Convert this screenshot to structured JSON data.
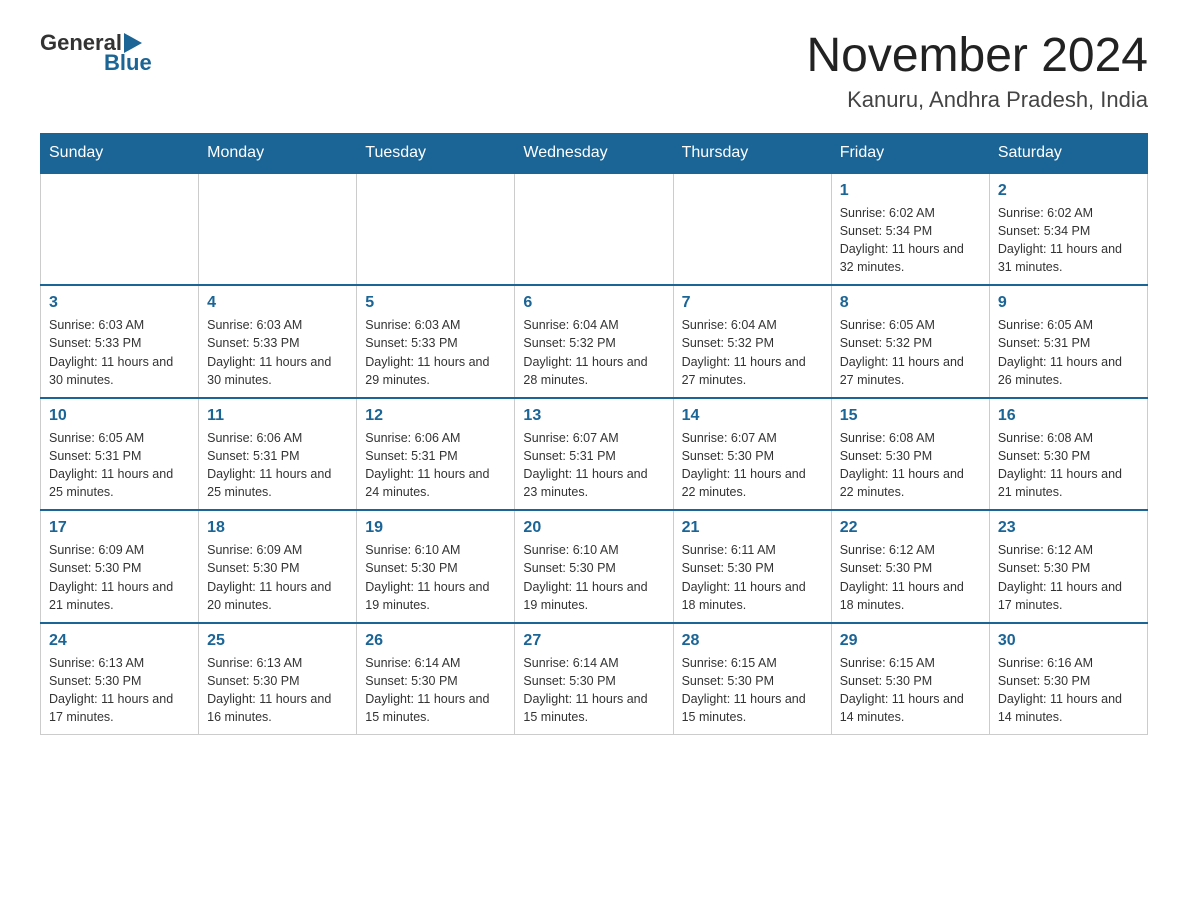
{
  "header": {
    "logo_general": "General",
    "logo_blue": "Blue",
    "title": "November 2024",
    "subtitle": "Kanuru, Andhra Pradesh, India"
  },
  "days_of_week": [
    "Sunday",
    "Monday",
    "Tuesday",
    "Wednesday",
    "Thursday",
    "Friday",
    "Saturday"
  ],
  "weeks": [
    [
      {
        "day": "",
        "sunrise": "",
        "sunset": "",
        "daylight": ""
      },
      {
        "day": "",
        "sunrise": "",
        "sunset": "",
        "daylight": ""
      },
      {
        "day": "",
        "sunrise": "",
        "sunset": "",
        "daylight": ""
      },
      {
        "day": "",
        "sunrise": "",
        "sunset": "",
        "daylight": ""
      },
      {
        "day": "",
        "sunrise": "",
        "sunset": "",
        "daylight": ""
      },
      {
        "day": "1",
        "sunrise": "Sunrise: 6:02 AM",
        "sunset": "Sunset: 5:34 PM",
        "daylight": "Daylight: 11 hours and 32 minutes."
      },
      {
        "day": "2",
        "sunrise": "Sunrise: 6:02 AM",
        "sunset": "Sunset: 5:34 PM",
        "daylight": "Daylight: 11 hours and 31 minutes."
      }
    ],
    [
      {
        "day": "3",
        "sunrise": "Sunrise: 6:03 AM",
        "sunset": "Sunset: 5:33 PM",
        "daylight": "Daylight: 11 hours and 30 minutes."
      },
      {
        "day": "4",
        "sunrise": "Sunrise: 6:03 AM",
        "sunset": "Sunset: 5:33 PM",
        "daylight": "Daylight: 11 hours and 30 minutes."
      },
      {
        "day": "5",
        "sunrise": "Sunrise: 6:03 AM",
        "sunset": "Sunset: 5:33 PM",
        "daylight": "Daylight: 11 hours and 29 minutes."
      },
      {
        "day": "6",
        "sunrise": "Sunrise: 6:04 AM",
        "sunset": "Sunset: 5:32 PM",
        "daylight": "Daylight: 11 hours and 28 minutes."
      },
      {
        "day": "7",
        "sunrise": "Sunrise: 6:04 AM",
        "sunset": "Sunset: 5:32 PM",
        "daylight": "Daylight: 11 hours and 27 minutes."
      },
      {
        "day": "8",
        "sunrise": "Sunrise: 6:05 AM",
        "sunset": "Sunset: 5:32 PM",
        "daylight": "Daylight: 11 hours and 27 minutes."
      },
      {
        "day": "9",
        "sunrise": "Sunrise: 6:05 AM",
        "sunset": "Sunset: 5:31 PM",
        "daylight": "Daylight: 11 hours and 26 minutes."
      }
    ],
    [
      {
        "day": "10",
        "sunrise": "Sunrise: 6:05 AM",
        "sunset": "Sunset: 5:31 PM",
        "daylight": "Daylight: 11 hours and 25 minutes."
      },
      {
        "day": "11",
        "sunrise": "Sunrise: 6:06 AM",
        "sunset": "Sunset: 5:31 PM",
        "daylight": "Daylight: 11 hours and 25 minutes."
      },
      {
        "day": "12",
        "sunrise": "Sunrise: 6:06 AM",
        "sunset": "Sunset: 5:31 PM",
        "daylight": "Daylight: 11 hours and 24 minutes."
      },
      {
        "day": "13",
        "sunrise": "Sunrise: 6:07 AM",
        "sunset": "Sunset: 5:31 PM",
        "daylight": "Daylight: 11 hours and 23 minutes."
      },
      {
        "day": "14",
        "sunrise": "Sunrise: 6:07 AM",
        "sunset": "Sunset: 5:30 PM",
        "daylight": "Daylight: 11 hours and 22 minutes."
      },
      {
        "day": "15",
        "sunrise": "Sunrise: 6:08 AM",
        "sunset": "Sunset: 5:30 PM",
        "daylight": "Daylight: 11 hours and 22 minutes."
      },
      {
        "day": "16",
        "sunrise": "Sunrise: 6:08 AM",
        "sunset": "Sunset: 5:30 PM",
        "daylight": "Daylight: 11 hours and 21 minutes."
      }
    ],
    [
      {
        "day": "17",
        "sunrise": "Sunrise: 6:09 AM",
        "sunset": "Sunset: 5:30 PM",
        "daylight": "Daylight: 11 hours and 21 minutes."
      },
      {
        "day": "18",
        "sunrise": "Sunrise: 6:09 AM",
        "sunset": "Sunset: 5:30 PM",
        "daylight": "Daylight: 11 hours and 20 minutes."
      },
      {
        "day": "19",
        "sunrise": "Sunrise: 6:10 AM",
        "sunset": "Sunset: 5:30 PM",
        "daylight": "Daylight: 11 hours and 19 minutes."
      },
      {
        "day": "20",
        "sunrise": "Sunrise: 6:10 AM",
        "sunset": "Sunset: 5:30 PM",
        "daylight": "Daylight: 11 hours and 19 minutes."
      },
      {
        "day": "21",
        "sunrise": "Sunrise: 6:11 AM",
        "sunset": "Sunset: 5:30 PM",
        "daylight": "Daylight: 11 hours and 18 minutes."
      },
      {
        "day": "22",
        "sunrise": "Sunrise: 6:12 AM",
        "sunset": "Sunset: 5:30 PM",
        "daylight": "Daylight: 11 hours and 18 minutes."
      },
      {
        "day": "23",
        "sunrise": "Sunrise: 6:12 AM",
        "sunset": "Sunset: 5:30 PM",
        "daylight": "Daylight: 11 hours and 17 minutes."
      }
    ],
    [
      {
        "day": "24",
        "sunrise": "Sunrise: 6:13 AM",
        "sunset": "Sunset: 5:30 PM",
        "daylight": "Daylight: 11 hours and 17 minutes."
      },
      {
        "day": "25",
        "sunrise": "Sunrise: 6:13 AM",
        "sunset": "Sunset: 5:30 PM",
        "daylight": "Daylight: 11 hours and 16 minutes."
      },
      {
        "day": "26",
        "sunrise": "Sunrise: 6:14 AM",
        "sunset": "Sunset: 5:30 PM",
        "daylight": "Daylight: 11 hours and 15 minutes."
      },
      {
        "day": "27",
        "sunrise": "Sunrise: 6:14 AM",
        "sunset": "Sunset: 5:30 PM",
        "daylight": "Daylight: 11 hours and 15 minutes."
      },
      {
        "day": "28",
        "sunrise": "Sunrise: 6:15 AM",
        "sunset": "Sunset: 5:30 PM",
        "daylight": "Daylight: 11 hours and 15 minutes."
      },
      {
        "day": "29",
        "sunrise": "Sunrise: 6:15 AM",
        "sunset": "Sunset: 5:30 PM",
        "daylight": "Daylight: 11 hours and 14 minutes."
      },
      {
        "day": "30",
        "sunrise": "Sunrise: 6:16 AM",
        "sunset": "Sunset: 5:30 PM",
        "daylight": "Daylight: 11 hours and 14 minutes."
      }
    ]
  ]
}
